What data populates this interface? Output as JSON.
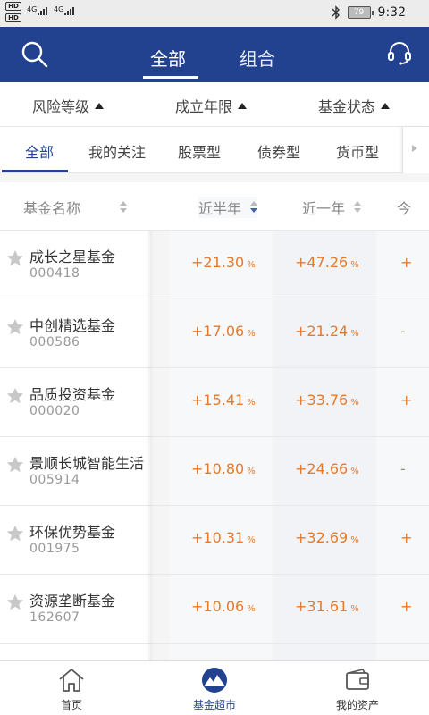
{
  "status_bar": {
    "hd1": "HD",
    "hd2": "HD",
    "net1": "4G",
    "net2": "4G",
    "battery": "79",
    "time": "9:32"
  },
  "nav": {
    "tabs": [
      {
        "label": "全部",
        "active": true
      },
      {
        "label": "组合",
        "active": false
      }
    ],
    "search_icon": "search-icon",
    "service_icon": "headset-icon",
    "bg_color": "#22418f"
  },
  "filters": [
    {
      "label": "风险等级"
    },
    {
      "label": "成立年限"
    },
    {
      "label": "基金状态"
    }
  ],
  "categories": [
    {
      "label": "全部",
      "active": true
    },
    {
      "label": "我的关注",
      "active": false
    },
    {
      "label": "股票型",
      "active": false
    },
    {
      "label": "债券型",
      "active": false
    },
    {
      "label": "货币型",
      "active": false
    }
  ],
  "table": {
    "headers": {
      "name": "基金名称",
      "half_year": "近半年",
      "one_year": "近一年",
      "third": "今"
    },
    "unit": "%",
    "value_color": "#e37a2e",
    "rows": [
      {
        "name": "成长之星基金",
        "code": "000418",
        "half_year": "+21.30",
        "one_year": "+47.26",
        "third": "+"
      },
      {
        "name": "中创精选基金",
        "code": "000586",
        "half_year": "+17.06",
        "one_year": "+21.24",
        "third": "-"
      },
      {
        "name": "品质投资基金",
        "code": "000020",
        "half_year": "+15.41",
        "one_year": "+33.76",
        "third": "+"
      },
      {
        "name": "景顺长城智能生活",
        "code": "005914",
        "half_year": "+10.80",
        "one_year": "+24.66",
        "third": "-"
      },
      {
        "name": "环保优势基金",
        "code": "001975",
        "half_year": "+10.31",
        "one_year": "+32.69",
        "third": "+"
      },
      {
        "name": "资源垄断基金",
        "code": "162607",
        "half_year": "+10.06",
        "one_year": "+31.61",
        "third": "+"
      }
    ]
  },
  "bottom_tabs": [
    {
      "label": "首页",
      "icon": "home-icon",
      "active": false
    },
    {
      "label": "基金超市",
      "icon": "fund-market-icon",
      "active": true
    },
    {
      "label": "我的资产",
      "icon": "wallet-icon",
      "active": false
    }
  ]
}
